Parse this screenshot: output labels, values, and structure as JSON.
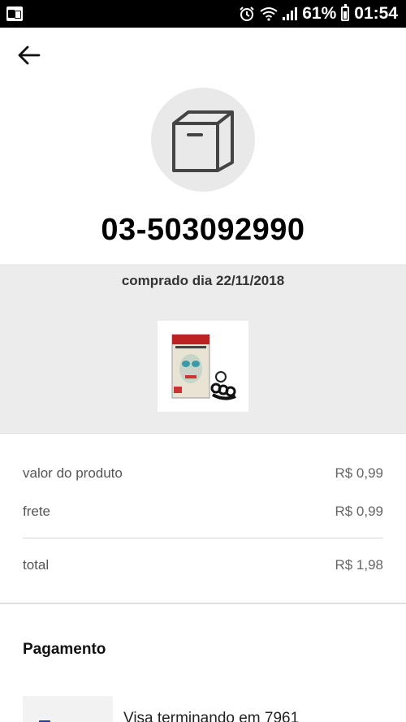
{
  "status_bar": {
    "battery_percent": "61%",
    "time": "01:54",
    "icons": [
      "outlook-notification-icon",
      "alarm-icon",
      "wifi-icon",
      "signal-icon",
      "battery-icon"
    ]
  },
  "header": {
    "back_icon": "arrow-left-icon",
    "package_icon": "box-icon",
    "order_number": "03-503092990"
  },
  "order": {
    "purchased_label": "comprado dia 22/11/2018",
    "product_image": "product-thumbnail"
  },
  "summary": {
    "product_value_label": "valor do produto",
    "product_value": "R$ 0,99",
    "shipping_label": "frete",
    "shipping_value": "R$ 0,99",
    "total_label": "total",
    "total_value": "R$ 1,98"
  },
  "payment": {
    "title": "Pagamento",
    "card_text": "Visa terminando em 7961"
  }
}
